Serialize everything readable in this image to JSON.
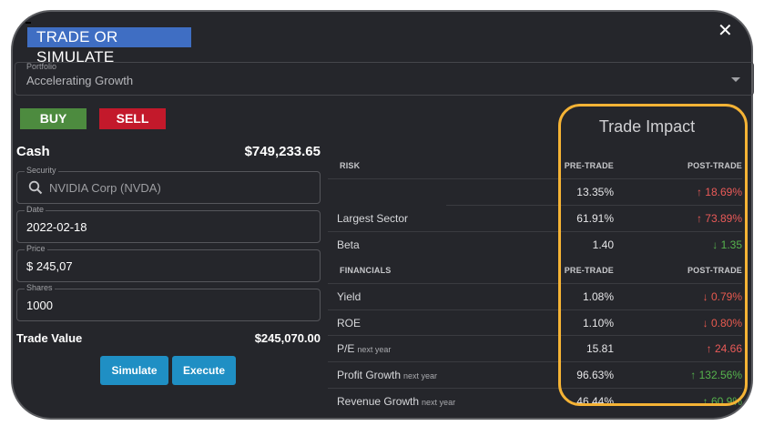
{
  "modal": {
    "title": "TRADE OR SIMULATE",
    "close_symbol": "✕"
  },
  "portfolio": {
    "label": "Portfolio",
    "value": "Accelerating Growth"
  },
  "actions": {
    "buy": "BUY",
    "sell": "SELL",
    "simulate": "Simulate",
    "execute": "Execute"
  },
  "cash": {
    "label": "Cash",
    "value": "$749,233.65"
  },
  "form": {
    "security": {
      "label": "Security",
      "value": "NVIDIA Corp (NVDA)"
    },
    "date": {
      "label": "Date",
      "value": "2022-02-18"
    },
    "price": {
      "label": "Price",
      "value": "$ 245,07"
    },
    "shares": {
      "label": "Shares",
      "value": "1000"
    }
  },
  "trade_value": {
    "label": "Trade Value",
    "value": "$245,070.00"
  },
  "impact": {
    "title": "Trade Impact",
    "risk_header": "RISK",
    "financials_header": "FINANCIALS",
    "pre_header": "PRE-TRADE",
    "post_header": "POST-TRADE",
    "risk_rows": [
      {
        "label": "",
        "sub": "",
        "pre": "13.35%",
        "arrow": "↑",
        "post": "18.69%"
      },
      {
        "label": "Largest Sector",
        "sub": "",
        "pre": "61.91%",
        "arrow": "↑",
        "post": "73.89%"
      },
      {
        "label": "Beta",
        "sub": "",
        "pre": "1.40",
        "arrow": "↓",
        "post": "1.35"
      }
    ],
    "financial_rows": [
      {
        "label": "Yield",
        "sub": "",
        "pre": "1.08%",
        "arrow": "↓",
        "post": "0.79%"
      },
      {
        "label": "ROE",
        "sub": "",
        "pre": "1.10%",
        "arrow": "↓",
        "post": "0.80%"
      },
      {
        "label": "P/E",
        "sub": "next year",
        "pre": "15.81",
        "arrow": "↑",
        "post": "24.66"
      },
      {
        "label": "Profit Growth",
        "sub": "next year",
        "pre": "96.63%",
        "arrow": "↑",
        "post": "132.56%"
      },
      {
        "label": "Revenue Growth",
        "sub": "next year",
        "pre": "46.44%",
        "arrow": "↑",
        "post": "60.9%"
      }
    ]
  },
  "colors": {
    "background": "#25262b",
    "buy": "#4d8b3f",
    "sell": "#c3192b",
    "button": "#1f8fc4",
    "increase_bad": "#ea5a58",
    "increase_good": "#56b34d",
    "highlight": "#f5b335"
  }
}
